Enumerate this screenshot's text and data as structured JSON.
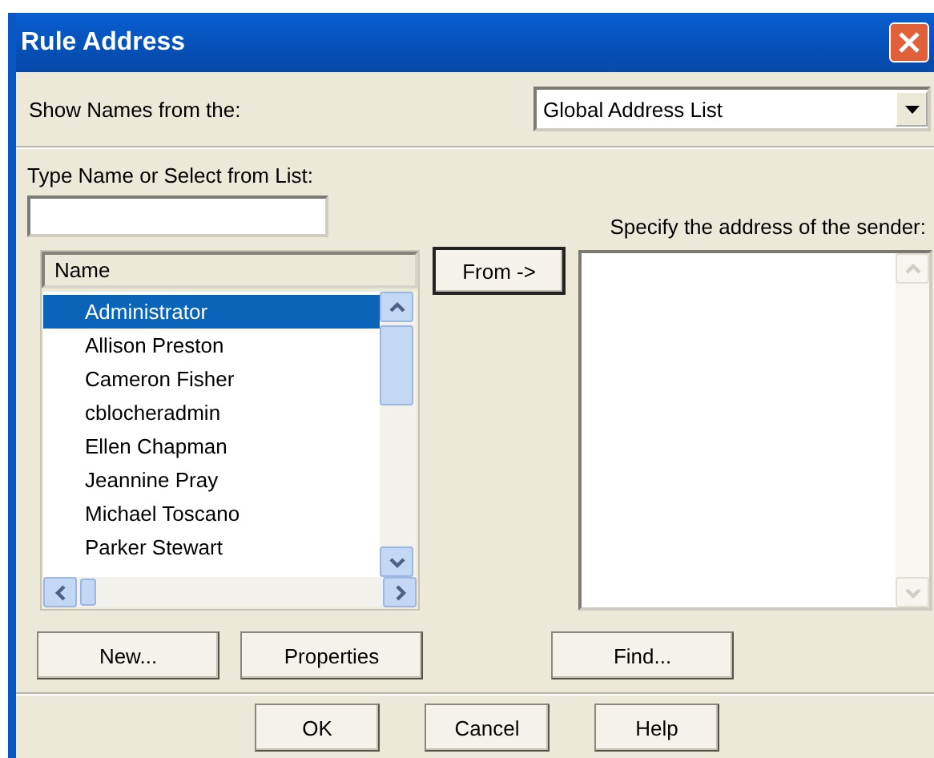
{
  "window": {
    "title": "Rule Address"
  },
  "show_names": {
    "label": "Show Names from the:",
    "value": "Global Address List"
  },
  "type_name": {
    "label": "Type Name or Select from List:"
  },
  "names": {
    "columns": [
      "Name"
    ],
    "items": [
      {
        "label": "Administrator",
        "selected": true
      },
      {
        "label": "Allison Preston",
        "selected": false
      },
      {
        "label": "Cameron Fisher",
        "selected": false
      },
      {
        "label": "cblocheradmin",
        "selected": false
      },
      {
        "label": "Ellen Chapman",
        "selected": false
      },
      {
        "label": "Jeannine Pray",
        "selected": false
      },
      {
        "label": "Michael Toscano",
        "selected": false
      },
      {
        "label": "Parker Stewart",
        "selected": false
      }
    ]
  },
  "from_button": "From ->",
  "sender": {
    "label": "Specify the address of the sender:"
  },
  "list_buttons": [
    "New...",
    "Properties"
  ],
  "find_button": "Find...",
  "dialog_buttons": [
    "OK",
    "Cancel",
    "Help"
  ]
}
